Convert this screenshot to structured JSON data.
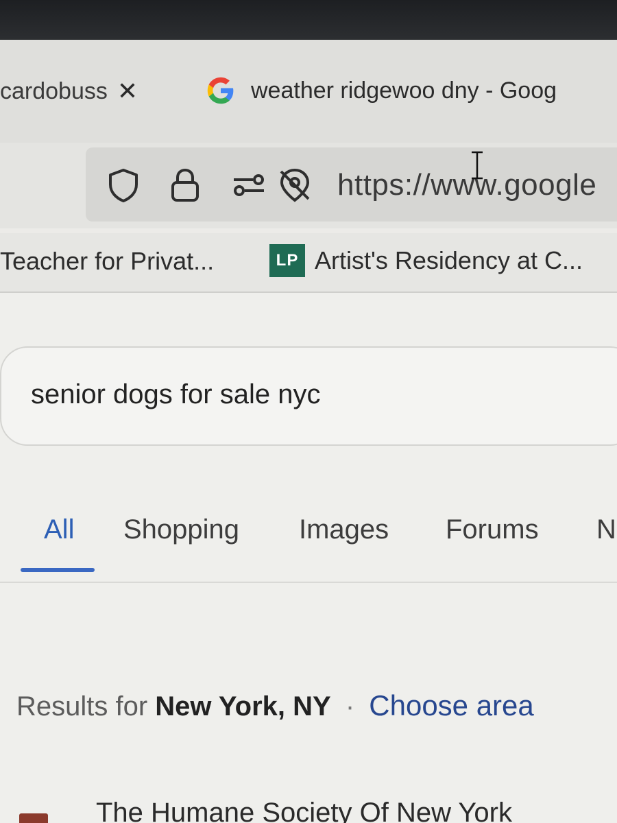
{
  "tabs": {
    "previous": {
      "label": "cardobuss",
      "close": "✕"
    },
    "active": {
      "label": "weather ridgewoo dny - Goog"
    }
  },
  "address_bar": {
    "url": "https://www.google",
    "icons": [
      "shield-icon",
      "lock-icon",
      "permissions-icon",
      "tracking-off-icon"
    ]
  },
  "bookmarks": {
    "items": [
      {
        "label": "Teacher for Privat..."
      },
      {
        "badge": "LP",
        "label": "Artist's Residency at C..."
      }
    ]
  },
  "search": {
    "query": "senior dogs for sale nyc"
  },
  "search_tabs": [
    {
      "label": "All"
    },
    {
      "label": "Shopping"
    },
    {
      "label": "Images"
    },
    {
      "label": "Forums"
    },
    {
      "label": "N"
    }
  ],
  "location": {
    "prefix": "Results for",
    "place": "New York, NY",
    "separator": "·",
    "action": "Choose area"
  },
  "results": [
    {
      "title": "The Humane Society Of New York"
    }
  ],
  "colors": {
    "accent": "#3a68c2",
    "link": "#27478f",
    "bookmark_badge": "#1f6b54"
  }
}
